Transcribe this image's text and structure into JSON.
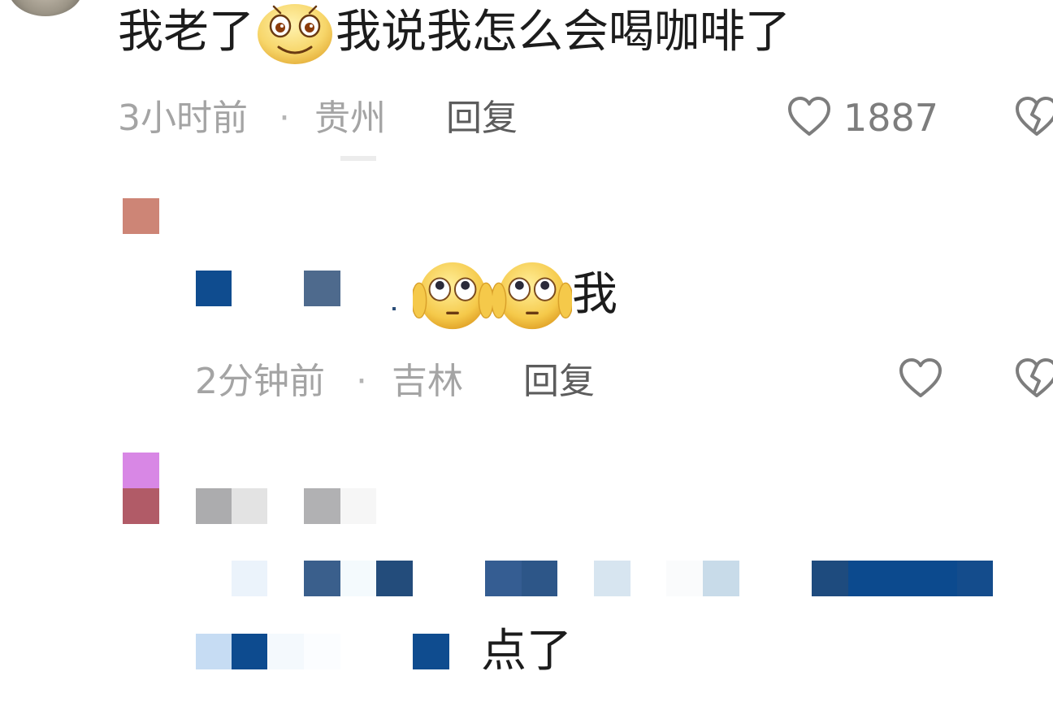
{
  "comments": [
    {
      "text_before": "我老了",
      "emoji_name": "smiling-face-emoji",
      "text_after": "我说我怎么会喝咖啡了",
      "time": "3小时前",
      "location": "贵州",
      "reply_label": "回复",
      "like_count": "1887"
    },
    {
      "emoji_name": "hear-no-evil-face-emoji",
      "text_after": "我",
      "time": "2分钟前",
      "location": "吉林",
      "reply_label": "回复",
      "like_count": ""
    },
    {
      "text_after": "点了"
    }
  ],
  "separator": "·",
  "icons": {
    "like": "heart-outline-icon",
    "dislike": "broken-heart-icon"
  },
  "colors": {
    "text": "#1c1c1c",
    "meta": "#a4a4a4",
    "reply": "#5c5c5c",
    "accent_blue": "#0d4b8f"
  }
}
